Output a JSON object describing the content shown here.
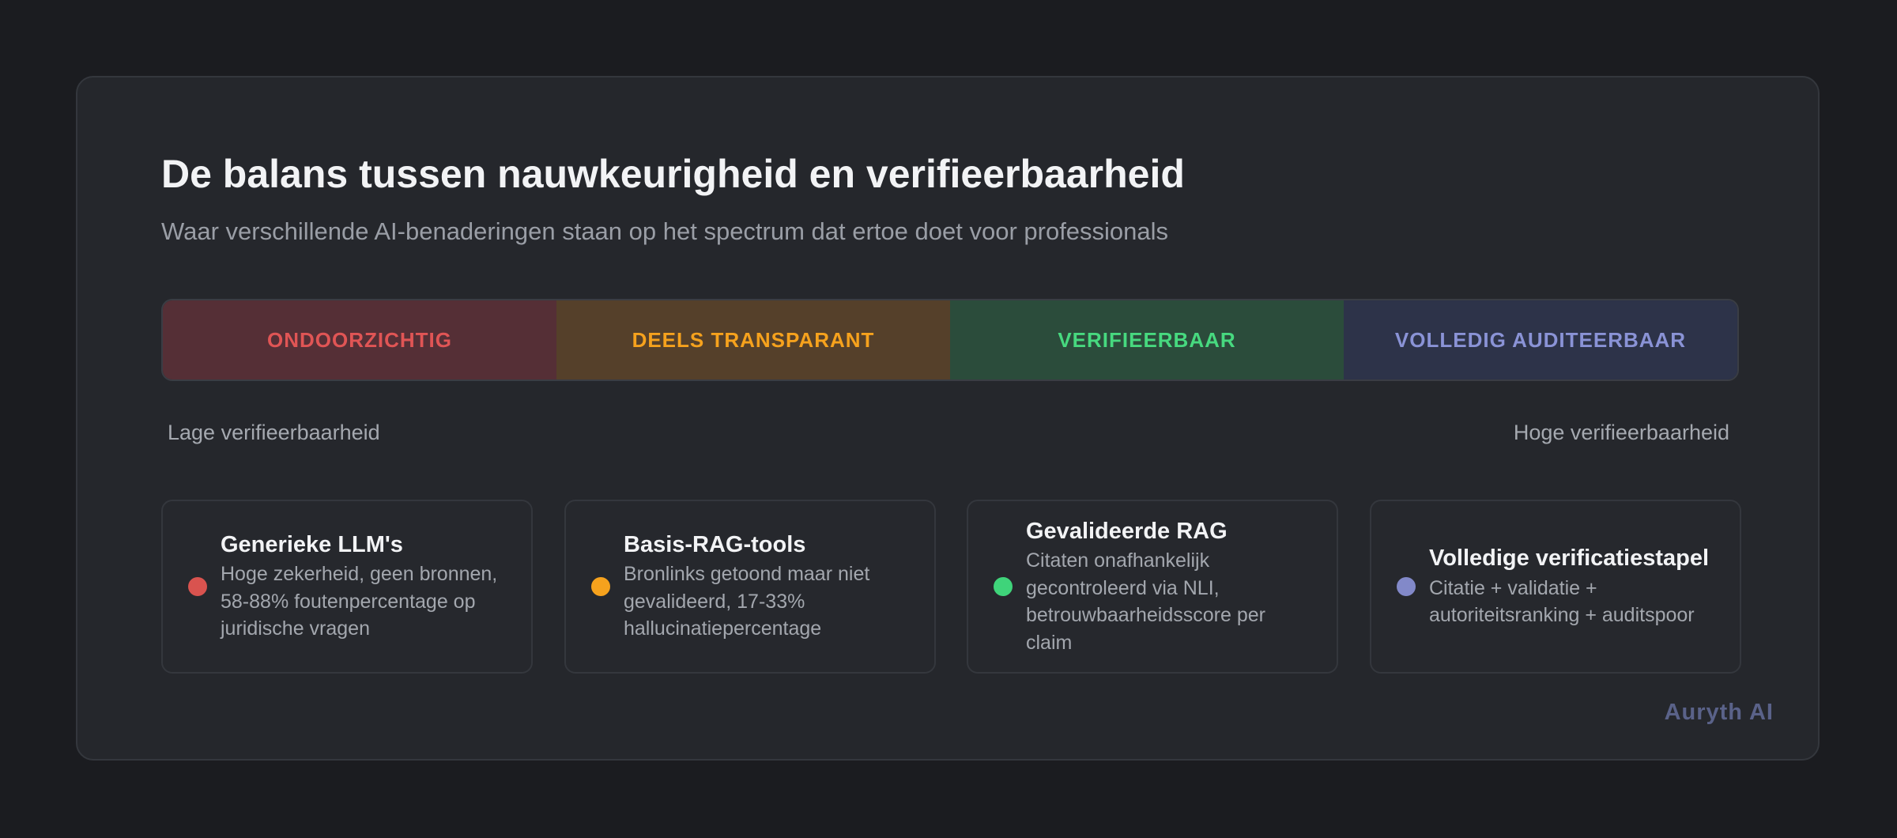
{
  "title": "De balans tussen nauwkeurigheid en verifieerbaarheid",
  "subtitle": "Waar verschillende AI-benaderingen staan op het spectrum dat ertoe doet voor professionals",
  "spectrum": {
    "segments": [
      {
        "label": "ONDOORZICHTIG",
        "color": "#e05555",
        "background": "#552f36"
      },
      {
        "label": "DEELS TRANSPARANT",
        "color": "#f6a21d",
        "background": "#55402a"
      },
      {
        "label": "VERIFIEERBAAR",
        "color": "#47d97f",
        "background": "#2b4c3b"
      },
      {
        "label": "VOLLEDIG AUDITEERBAAR",
        "color": "#8a93d6",
        "background": "#2d3349"
      }
    ],
    "low_label": "Lage verifieerbaarheid",
    "high_label": "Hoge verifieerbaarheid"
  },
  "approaches": [
    {
      "name": "Generieke LLM's",
      "description": "Hoge zekerheid, geen bronnen, 58-88% foutenpercentage op juridische vragen",
      "dot_color": "#d9534f"
    },
    {
      "name": "Basis-RAG-tools",
      "description": "Bronlinks getoond maar niet gevalideerd, 17-33% hallucinatiepercentage",
      "dot_color": "#f6a21d"
    },
    {
      "name": "Gevalideerde RAG",
      "description": "Citaten onafhankelijk gecontroleerd via NLI, betrouwbaarheidsscore per claim",
      "dot_color": "#3fd47a"
    },
    {
      "name": "Volledige verificatiestapel",
      "description": "Citatie + validatie + autoriteitsranking + auditspoor",
      "dot_color": "#8289c9"
    }
  ],
  "brand": "Auryth AI"
}
